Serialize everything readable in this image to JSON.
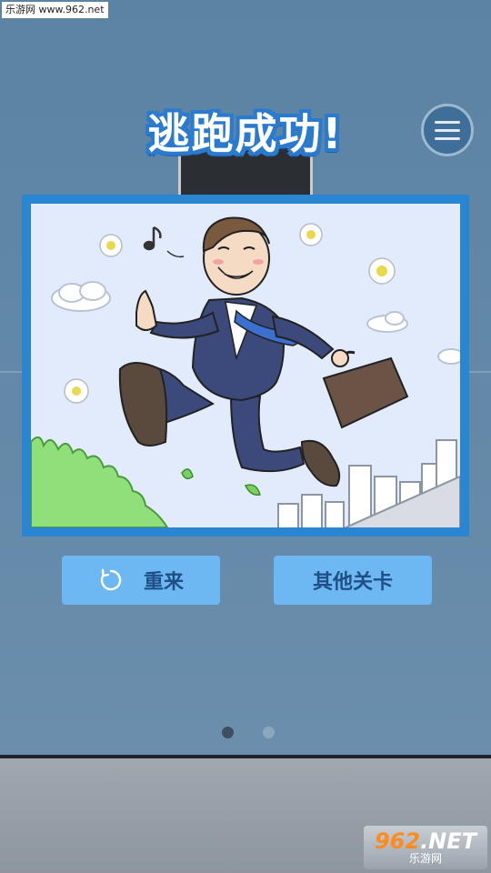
{
  "watermark_top": "乐游网 www.962.net",
  "title": "逃跑成功!",
  "buttons": {
    "retry_label": "重来",
    "other_levels_label": "其他关卡"
  },
  "pagination": {
    "total": 2,
    "current": 1
  },
  "watermark_logo": {
    "brand": "962",
    "suffix": ".NET",
    "sub": "乐游网"
  },
  "colors": {
    "title_outline": "#2a7ad0",
    "frame": "#2b86d2",
    "button_bg": "#6db8f2",
    "button_text": "#1f4f86"
  }
}
